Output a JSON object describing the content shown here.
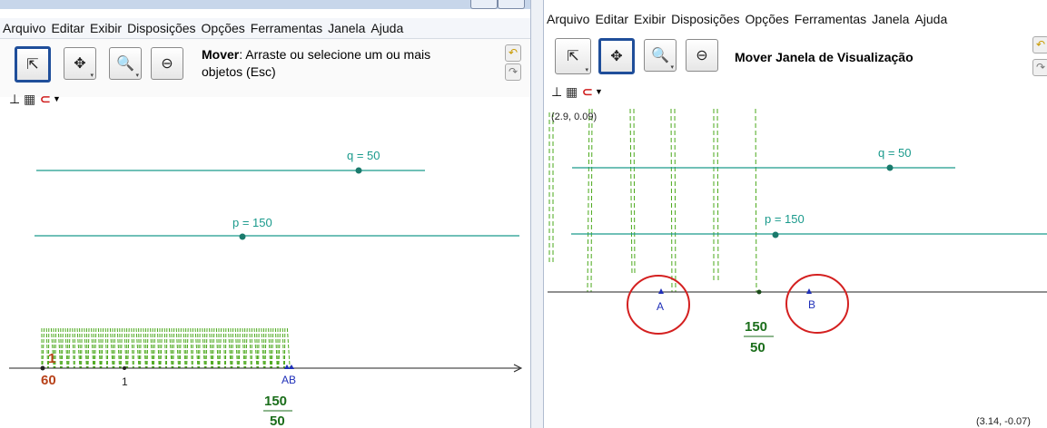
{
  "menu": [
    "Arquivo",
    "Editar",
    "Exibir",
    "Disposições",
    "Opções",
    "Ferramentas",
    "Janela",
    "Ajuda"
  ],
  "left": {
    "tool_name": "Mover",
    "tool_desc": ": Arraste ou selecione um ou mais",
    "tool_desc2": "objetos (Esc)",
    "line_q_label": "q = 50",
    "line_p_label": "p = 150",
    "fraction_num": "150",
    "fraction_den": "50",
    "red_label_top": "1",
    "red_label_bottom": "60",
    "tick_label_1": "1",
    "point_label": "AB"
  },
  "right": {
    "tool_name": "Mover Janela de Visualização",
    "corner_top_left": "(2.9, 0.09)",
    "corner_bottom_right": "(3.14, -0.07)",
    "line_q_label": "q = 50",
    "line_p_label": "p = 150",
    "point_a_label": "A",
    "point_b_label": "B",
    "fraction_num": "150",
    "fraction_den": "50"
  },
  "colors": {
    "teal": "#1a9a8c",
    "green_dash": "#4aa81a",
    "blue_point": "#1f2fb8",
    "red_circle": "#d42020",
    "fraction_green": "#1b6e1b",
    "red_text": "#b8421a"
  },
  "icons": {
    "arrow": "cursor-arrow-icon",
    "move": "move-cross-icon",
    "zoom_in": "zoom-in-icon",
    "zoom_out": "zoom-out-icon",
    "undo": "undo-icon",
    "redo": "redo-icon",
    "axes": "axes-toggle-icon",
    "grid": "grid-toggle-icon",
    "magnet": "point-capture-icon"
  }
}
